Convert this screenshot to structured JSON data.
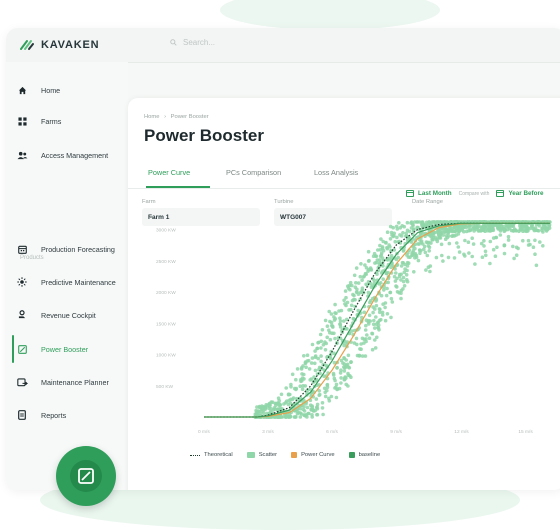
{
  "app": {
    "logo_text": "KAVAKEN",
    "search_placeholder": "Search..."
  },
  "sidebar": {
    "items": [
      {
        "label": "Home",
        "icon": "home-icon"
      },
      {
        "label": "Farms",
        "icon": "grid-icon"
      },
      {
        "label": "Access Management",
        "icon": "users-icon"
      }
    ],
    "section_label": "Products",
    "products": [
      {
        "label": "Production Forecasting",
        "icon": "calendar-icon"
      },
      {
        "label": "Predictive Maintenance",
        "icon": "sun-icon"
      },
      {
        "label": "Revenue Cockpit",
        "icon": "money-icon"
      },
      {
        "label": "Power Booster",
        "icon": "chart-box-icon",
        "active": true
      },
      {
        "label": "Maintenance Planner",
        "icon": "planner-icon"
      },
      {
        "label": "Reports",
        "icon": "document-icon"
      }
    ],
    "collapse_label": "⟨"
  },
  "breadcrumb": {
    "home": "Home",
    "separator": "›",
    "current": "Power Booster"
  },
  "page_title": "Power Booster",
  "tabs": [
    {
      "label": "Power Curve",
      "active": true
    },
    {
      "label": "PCs Comparison",
      "active": false
    },
    {
      "label": "Loss Analysis",
      "active": false
    }
  ],
  "filters": {
    "farm": {
      "label": "Farm",
      "value": "Farm 1"
    },
    "turbine": {
      "label": "Turbine",
      "value": "WTG007"
    },
    "date_range": {
      "label": "Date Range",
      "value": "Last Month",
      "compare_label": "Compare with",
      "compare_value": "Year Before"
    }
  },
  "colors": {
    "accent": "#2f9e5b",
    "scatter": "#8fd6a8",
    "power_curve": "#e8a04a",
    "baseline": "#3a9d5d",
    "theoretical": "#1d3b2a"
  },
  "chart_data": {
    "type": "scatter",
    "y_ticks": [
      "3000 KW",
      "2500 KW",
      "2000 KW",
      "1500 KW",
      "1000 KW",
      "500 KW"
    ],
    "x_ticks": [
      "0 m/s",
      "3 m/s",
      "6 m/s",
      "9 m/s",
      "12 m/s",
      "15 m/s"
    ],
    "xlim": [
      0,
      16.2
    ],
    "ylim": [
      0,
      3200
    ],
    "series": [
      {
        "name": "Theoretical",
        "style": "dotted",
        "x": [
          0,
          2.5,
          3,
          4,
          5,
          6,
          7,
          8,
          9,
          10,
          11,
          12,
          13,
          16.2
        ],
        "y": [
          0,
          0,
          30,
          150,
          500,
          1050,
          1700,
          2300,
          2750,
          3000,
          3080,
          3100,
          3100,
          3100
        ]
      },
      {
        "name": "Power Curve",
        "style": "line",
        "x": [
          0,
          2.5,
          3,
          4,
          5,
          6,
          7,
          8,
          9,
          10,
          11,
          12,
          13,
          16.2
        ],
        "y": [
          0,
          0,
          10,
          70,
          300,
          750,
          1300,
          1900,
          2450,
          2850,
          3030,
          3090,
          3100,
          3100
        ]
      },
      {
        "name": "baseline",
        "style": "line",
        "x": [
          0,
          2.5,
          3,
          4,
          5,
          6,
          7,
          8,
          9,
          10,
          11,
          12,
          13,
          16.2
        ],
        "y": [
          0,
          0,
          20,
          110,
          400,
          900,
          1500,
          2100,
          2600,
          2950,
          3060,
          3100,
          3100,
          3100
        ]
      }
    ],
    "scatter_name": "Scatter",
    "grid": false,
    "legend": "bottom"
  }
}
